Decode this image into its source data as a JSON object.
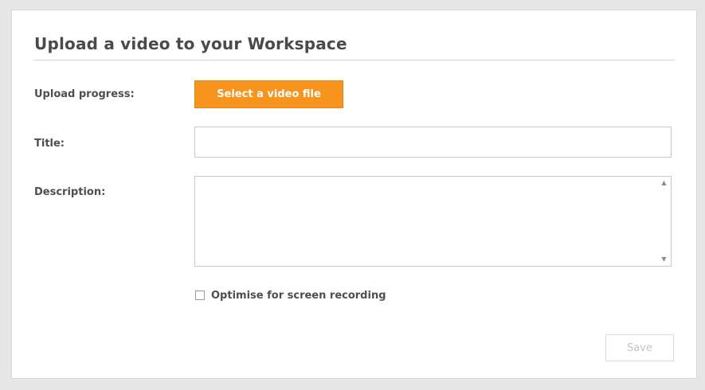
{
  "form": {
    "heading": "Upload a video to your Workspace",
    "upload_progress_label": "Upload progress:",
    "select_file_button": "Select a video file",
    "title_label": "Title:",
    "title_value": "",
    "description_label": "Description:",
    "description_value": "",
    "optimise_checkbox_label": "Optimise for screen recording",
    "optimise_checked": false,
    "save_button": "Save",
    "save_enabled": false
  },
  "colors": {
    "accent": "#f7941d",
    "background": "#e6e6e6",
    "panel": "#ffffff",
    "disabled_text": "#c4c4c4"
  },
  "icons": {
    "scroll_up": "scroll-up-arrow-icon",
    "scroll_down": "scroll-down-arrow-icon",
    "checkbox": "checkbox-unchecked-icon"
  }
}
